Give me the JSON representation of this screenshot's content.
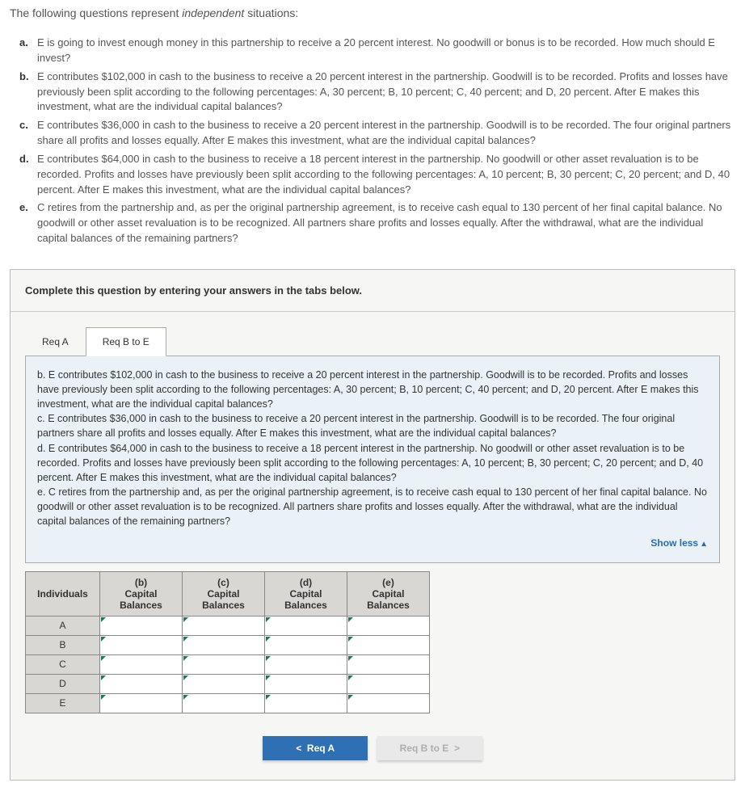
{
  "intro": {
    "prefix": "The following questions represent ",
    "em": "independent",
    "suffix": " situations:"
  },
  "questions": [
    {
      "marker": "a.",
      "text": "E is going to invest enough money in this partnership to receive a 20 percent interest. No goodwill or bonus is to be recorded. How much should E invest?"
    },
    {
      "marker": "b.",
      "text": "E contributes $102,000 in cash to the business to receive a 20 percent interest in the partnership. Goodwill is to be recorded. Profits and losses have previously been split according to the following percentages: A, 30 percent; B, 10 percent; C, 40 percent; and D, 20 percent. After E makes this investment, what are the individual capital balances?"
    },
    {
      "marker": "c.",
      "text": "E contributes $36,000 in cash to the business to receive a 20 percent interest in the partnership. Goodwill is to be recorded. The four original partners share all profits and losses equally. After E makes this investment, what are the individual capital balances?"
    },
    {
      "marker": "d.",
      "text": "E contributes $64,000 in cash to the business to receive a 18 percent interest in the partnership. No goodwill or other asset revaluation is to be recorded. Profits and losses have previously been split according to the following percentages: A, 10 percent; B, 30 percent; C, 20 percent; and D, 40 percent. After E makes this investment, what are the individual capital balances?"
    },
    {
      "marker": "e.",
      "text": "C retires from the partnership and, as per the original partnership agreement, is to receive cash equal to 130 percent of her final capital balance. No goodwill or other asset revaluation is to be recognized. All partners share profits and losses equally. After the withdrawal, what are the individual capital balances of the remaining partners?"
    }
  ],
  "instruct": "Complete this question by entering your answers in the tabs below.",
  "tabs": {
    "a": "Req A",
    "b": "Req B to E"
  },
  "panel": {
    "b": "b. E contributes $102,000 in cash to the business to receive a 20 percent interest in the partnership. Goodwill is to be recorded. Profits and losses have previously been split according to the following percentages: A, 30 percent; B, 10 percent; C, 40 percent; and D, 20 percent. After E makes this investment, what are the individual capital balances?",
    "c": "c. E contributes $36,000 in cash to the business to receive a 20 percent interest in the partnership. Goodwill is to be recorded. The four original partners share all profits and losses equally. After E makes this investment, what are the individual capital balances?",
    "d": "d. E contributes $64,000 in cash to the business to receive a 18 percent interest in the partnership. No goodwill or other asset revaluation is to be recorded. Profits and losses have previously been split according to the following percentages: A, 10 percent; B, 30 percent; C, 20 percent; and D, 40 percent. After E makes this investment, what are the individual capital balances?",
    "e": "e. C retires from the partnership and, as per the original partnership agreement, is to receive cash equal to 130 percent of her final capital balance. No goodwill or other asset revaluation is to be recognized. All partners share profits and losses equally. After the withdrawal, what are the individual capital balances of the remaining partners?"
  },
  "show_less": "Show less",
  "table": {
    "headers": {
      "col0": "Individuals",
      "col1_a": "(b)",
      "col1_b": "Capital Balances",
      "col2_a": "(c)",
      "col2_b": "Capital Balances",
      "col3_a": "(d)",
      "col3_b": "Capital Balances",
      "col4_a": "(e)",
      "col4_b": "Capital Balances"
    },
    "rows": [
      "A",
      "B",
      "C",
      "D",
      "E"
    ]
  },
  "nav": {
    "prev": "Req A",
    "next": "Req B to E"
  },
  "glyph": {
    "left": "<",
    "right": ">",
    "up": "▲"
  }
}
